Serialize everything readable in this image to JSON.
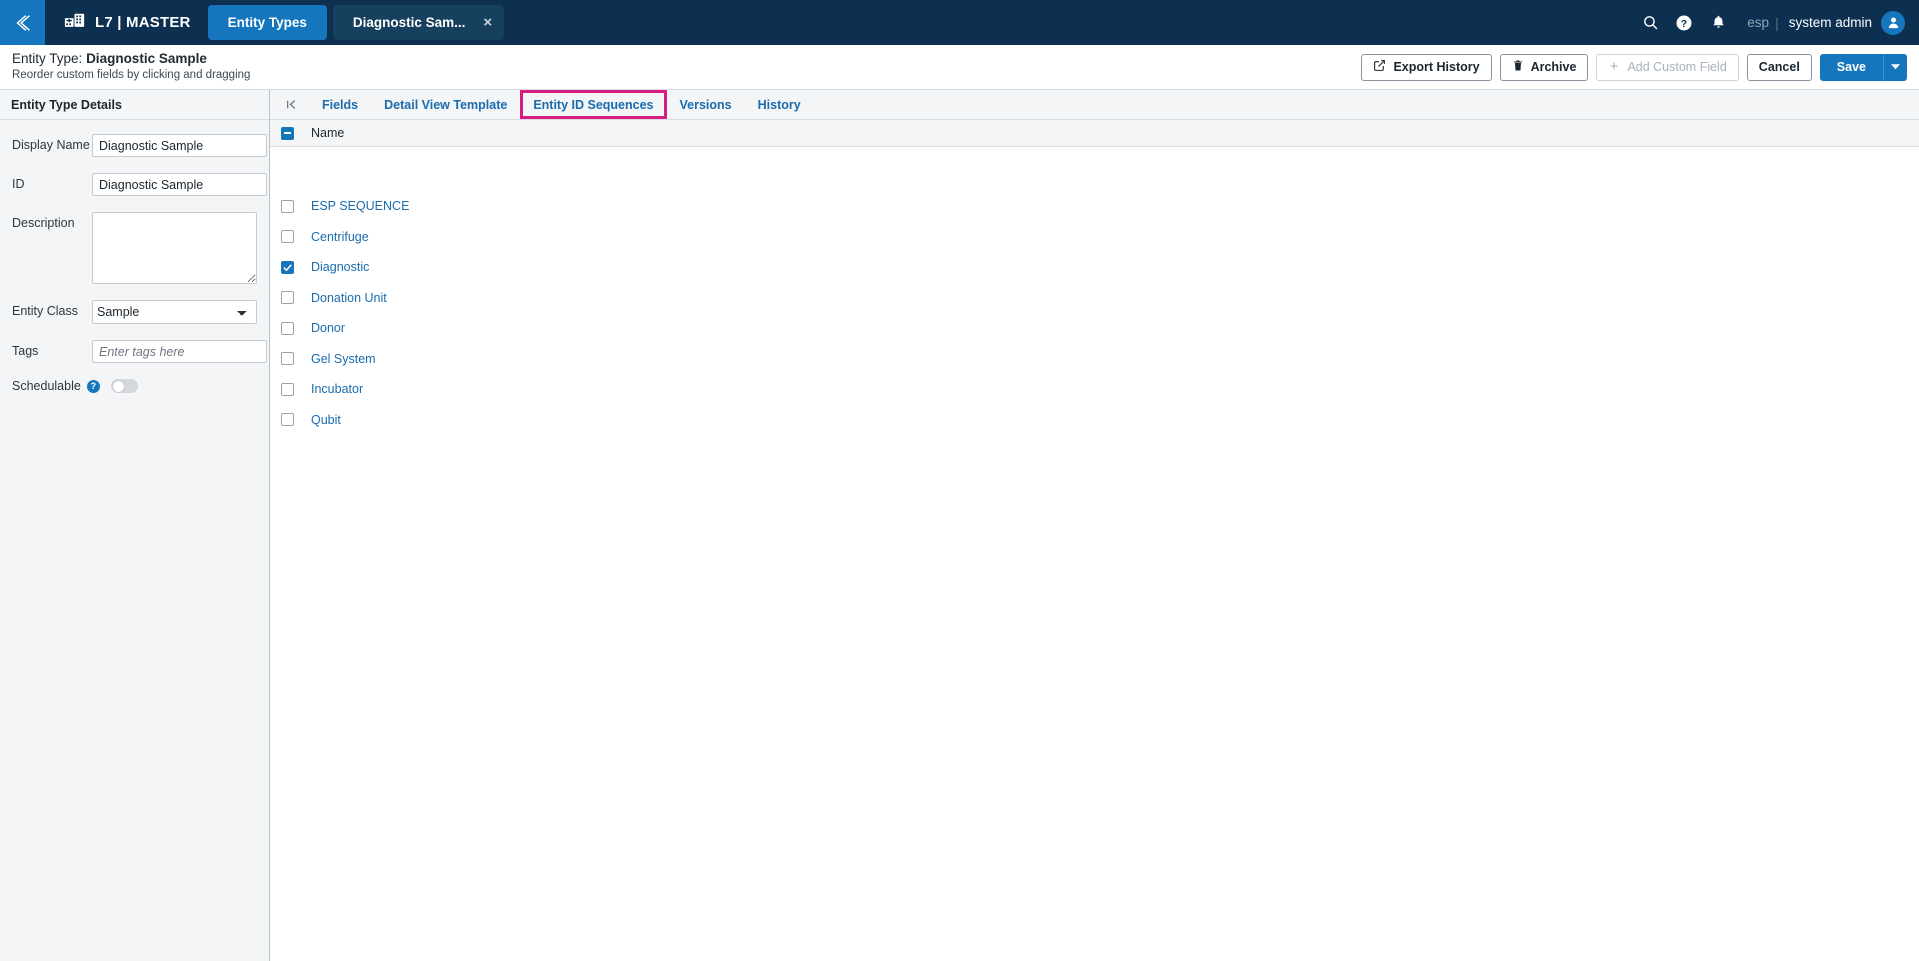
{
  "topbar": {
    "back_icon": "chevron-double-left-icon",
    "brand_logo_icon": "l7-building-icon",
    "brand_text": "L7 | MASTER",
    "nav_tab_entity_types": "Entity Types",
    "open_doc_tab": "Diagnostic Sam...",
    "doc_tab_close": "×",
    "search_icon": "search-icon",
    "help_icon": "help-circle-icon",
    "notification_icon": "bell-icon",
    "org_label": "esp",
    "separator": "|",
    "user_name": "system admin",
    "avatar_icon": "user-avatar-icon"
  },
  "subheader": {
    "title_prefix": "Entity Type:",
    "title_value": "Diagnostic Sample",
    "subtitle": "Reorder custom fields by clicking and dragging",
    "buttons": {
      "export_history": "Export History",
      "export_history_icon": "external-link-icon",
      "archive": "Archive",
      "archive_icon": "trash-icon",
      "add_custom_field": "Add Custom Field",
      "add_custom_field_icon": "plus-icon",
      "cancel": "Cancel",
      "save": "Save",
      "save_dropdown_icon": "caret-down-icon"
    }
  },
  "left_panel": {
    "header_title": "Entity Type Details",
    "fields": {
      "display_name_label": "Display Name",
      "display_name_value": "Diagnostic Sample",
      "id_label": "ID",
      "id_value": "Diagnostic Sample",
      "description_label": "Description",
      "description_value": "",
      "entity_class_label": "Entity Class",
      "entity_class_value": "Sample",
      "entity_class_options": [
        "Sample"
      ],
      "tags_label": "Tags",
      "tags_value": "",
      "tags_placeholder": "Enter tags here",
      "schedulable_label": "Schedulable",
      "schedulable_help_icon": "question-mark-icon",
      "schedulable_on": false
    }
  },
  "content": {
    "collapse_icon": "collapse-panel-left-icon",
    "tabs": [
      {
        "label": "Fields",
        "active": false
      },
      {
        "label": "Detail View Template",
        "active": false
      },
      {
        "label": "Entity ID Sequences",
        "active": true
      },
      {
        "label": "Versions",
        "active": false
      },
      {
        "label": "History",
        "active": false
      }
    ],
    "grid": {
      "header_checkbox_state": "indeterminate",
      "column_header": "Name",
      "rows": [
        {
          "name": "ESP SEQUENCE",
          "checked": false
        },
        {
          "name": "Centrifuge",
          "checked": false
        },
        {
          "name": "Diagnostic",
          "checked": true
        },
        {
          "name": "Donation Unit",
          "checked": false
        },
        {
          "name": "Donor",
          "checked": false
        },
        {
          "name": "Gel System",
          "checked": false
        },
        {
          "name": "Incubator",
          "checked": false
        },
        {
          "name": "Qubit",
          "checked": false
        }
      ]
    }
  },
  "colors": {
    "nav_dark": "#0d3050",
    "accent_blue": "#1676bd",
    "highlight_pink": "#d91c81",
    "link_blue": "#1a6cae"
  }
}
